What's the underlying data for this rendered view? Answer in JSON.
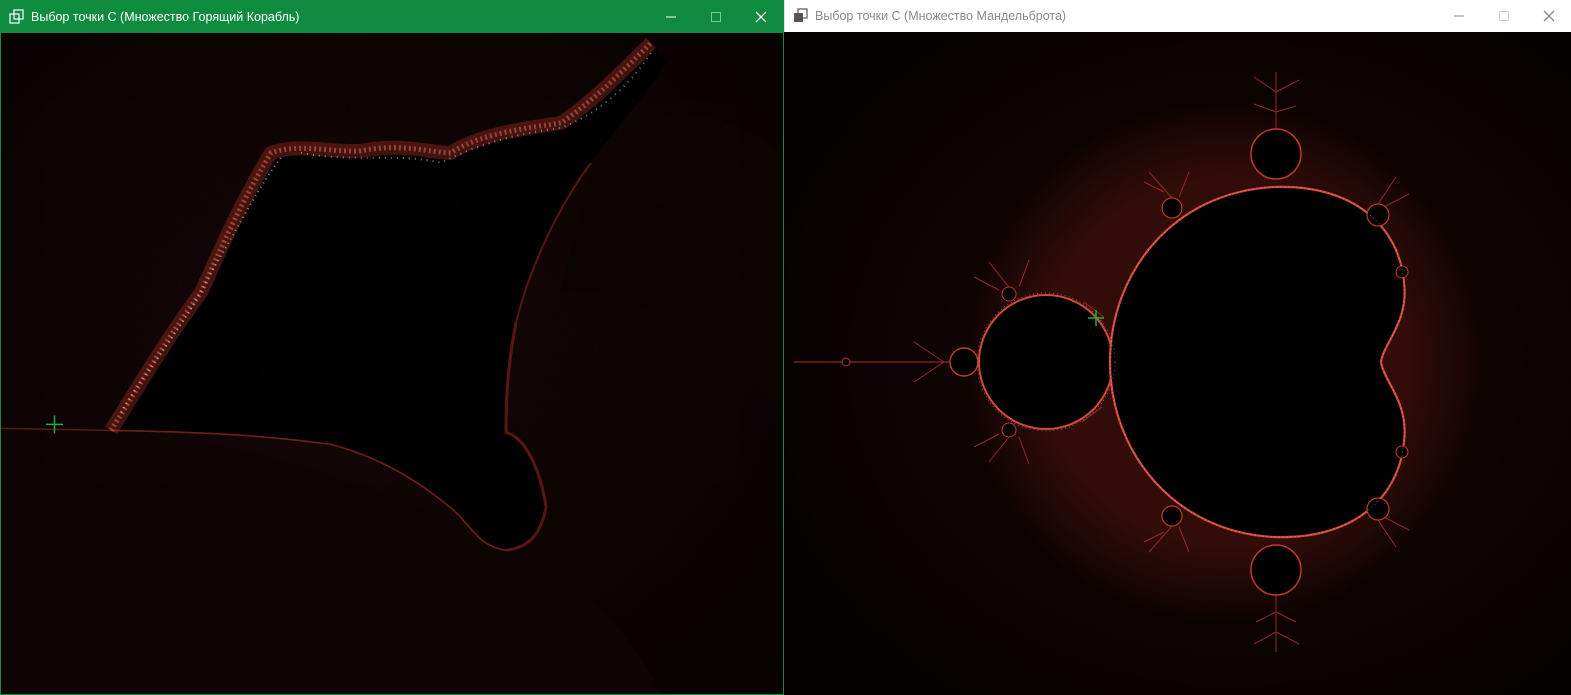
{
  "windows": {
    "left": {
      "title": "Выбор точки С (Множество Горящий Корабль)",
      "active": true,
      "accent": "#0f8b3f",
      "icons": {
        "app": "window-icon",
        "minimize": "minimize-icon",
        "maximize": "maximize-icon",
        "close": "close-icon"
      }
    },
    "right": {
      "title": "Выбор точки С (Множество Мандельброта)",
      "active": false,
      "icons": {
        "app": "window-icon",
        "minimize": "minimize-icon",
        "maximize": "maximize-icon",
        "close": "close-icon"
      }
    }
  },
  "colors": {
    "fractal_fill": "#000000",
    "fractal_edge": "#c0392b",
    "fractal_glow": "#f6d4c8",
    "background": "#0a0303",
    "crosshair": "#1fae3a"
  }
}
